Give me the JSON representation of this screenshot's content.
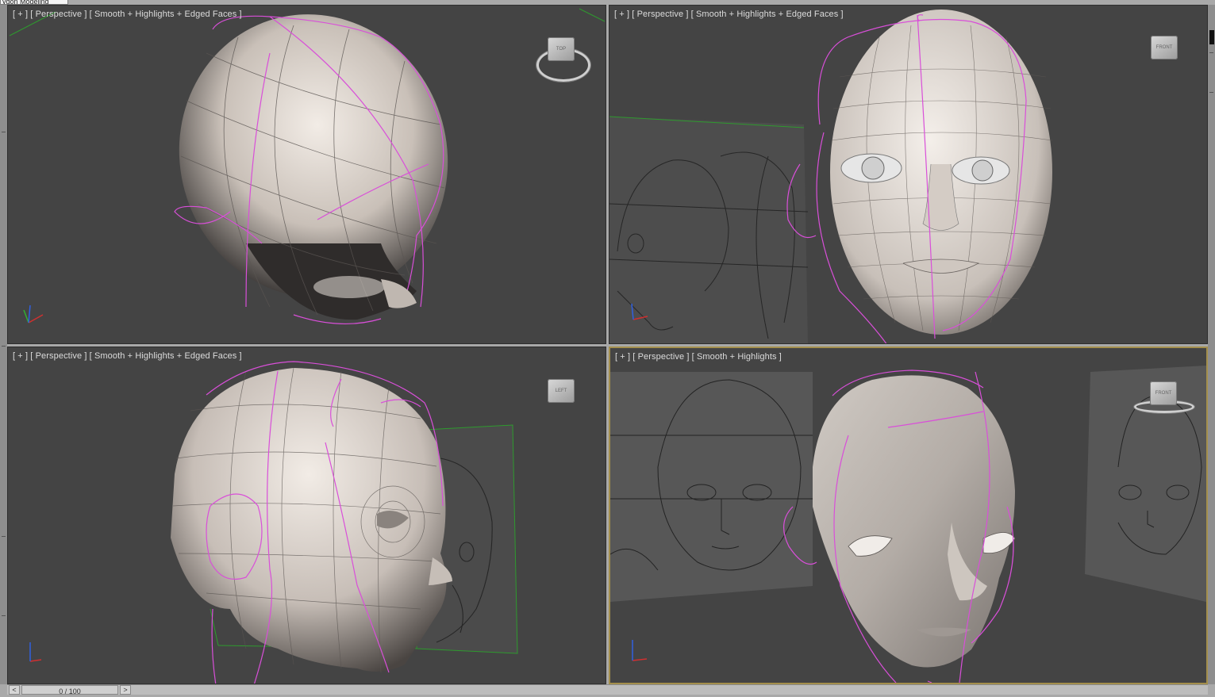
{
  "window": {
    "top_tab_label": "ygon Modeling"
  },
  "viewports": [
    {
      "id": "top-left",
      "label": "[ + ] [ Perspective ] [ Smooth + Highlights + Edged Faces ]",
      "viewcube_face": "TOP",
      "active": false
    },
    {
      "id": "top-right",
      "label": "[ + ] [ Perspective ] [ Smooth + Highlights + Edged Faces ]",
      "viewcube_face": "FRONT",
      "active": false
    },
    {
      "id": "bottom-left",
      "label": "[ + ] [ Perspective ] [ Smooth + Highlights + Edged Faces ]",
      "viewcube_face": "LEFT",
      "active": false
    },
    {
      "id": "bottom-right",
      "label": "[ + ] [ Perspective ] [ Smooth + Highlights ]",
      "viewcube_face": "FRONT",
      "active": true
    }
  ],
  "axis_labels": {
    "x": "x",
    "y": "y",
    "z": "z"
  },
  "timeline": {
    "frame_readout": "0 / 100",
    "prev_label": "<",
    "next_label": ">"
  },
  "colors": {
    "viewport_bg": "#444444",
    "active_border": "#a48f4c",
    "spline": "#d94fd9",
    "wire": "#4a4a4a",
    "grid_green": "#2e9a2e",
    "axis_x": "#d03030",
    "axis_y": "#30b030",
    "axis_z": "#3060e0"
  },
  "icons": [
    "viewcube-icon",
    "axis-tripod-icon",
    "head-mesh",
    "reference-sketch"
  ]
}
